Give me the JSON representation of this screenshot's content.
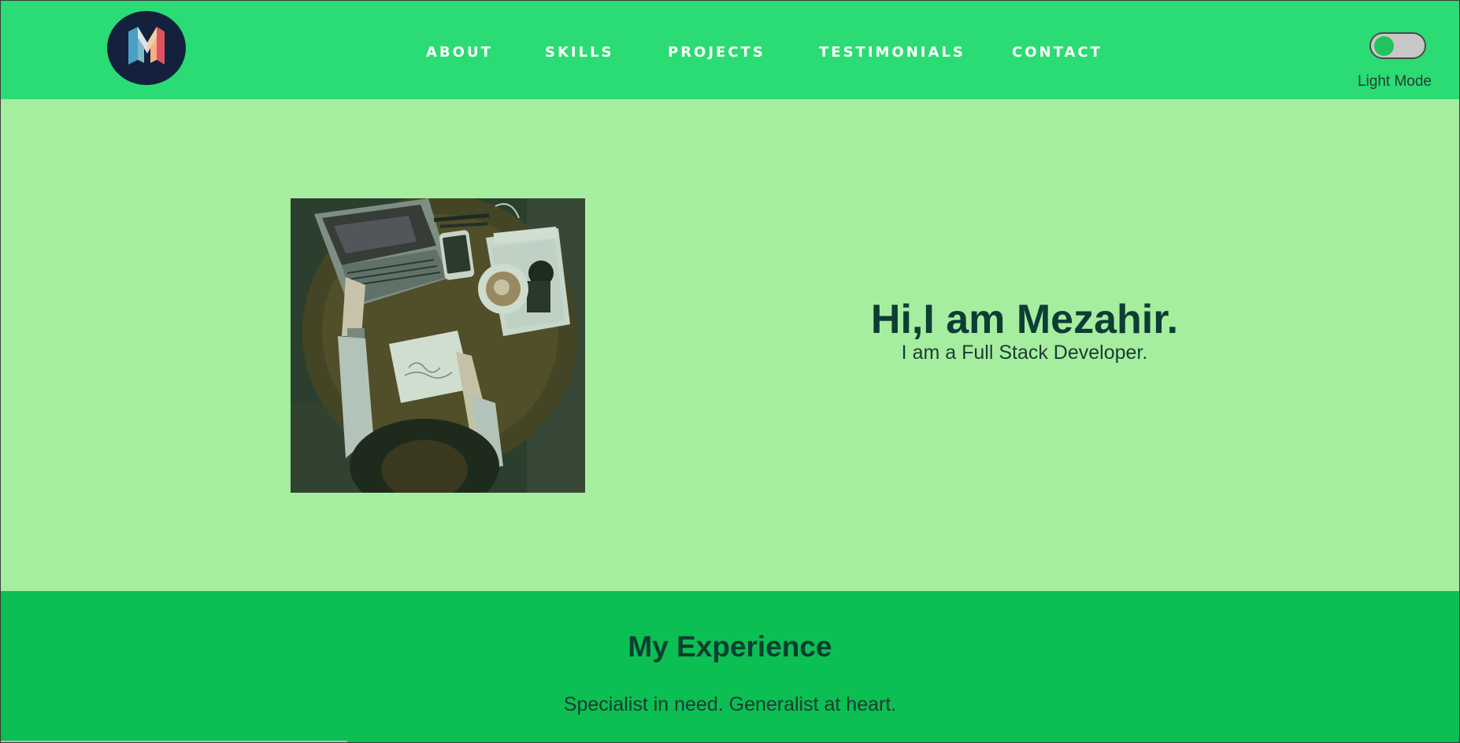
{
  "nav": {
    "logo_letter": "M",
    "links": [
      {
        "label": "ABOUT"
      },
      {
        "label": "SKILLS"
      },
      {
        "label": "PROJECTS"
      },
      {
        "label": "TESTIMONIALS"
      },
      {
        "label": "CONTACT"
      }
    ],
    "mode_label": "Light Mode",
    "toggle_state": "off"
  },
  "hero": {
    "title": "Hi,I am Mezahir.",
    "subtitle": "I am a Full Stack Developer.",
    "image_alt": "workspace-photo"
  },
  "experience": {
    "title": "My Experience",
    "subtitle": "Specialist in need. Generalist at heart."
  },
  "colors": {
    "nav_bg": "#2adc73",
    "hero_bg": "#a6ee9f",
    "experience_bg": "#0bbf52",
    "heading": "#0d3d35",
    "logo_bg": "#14213d"
  }
}
